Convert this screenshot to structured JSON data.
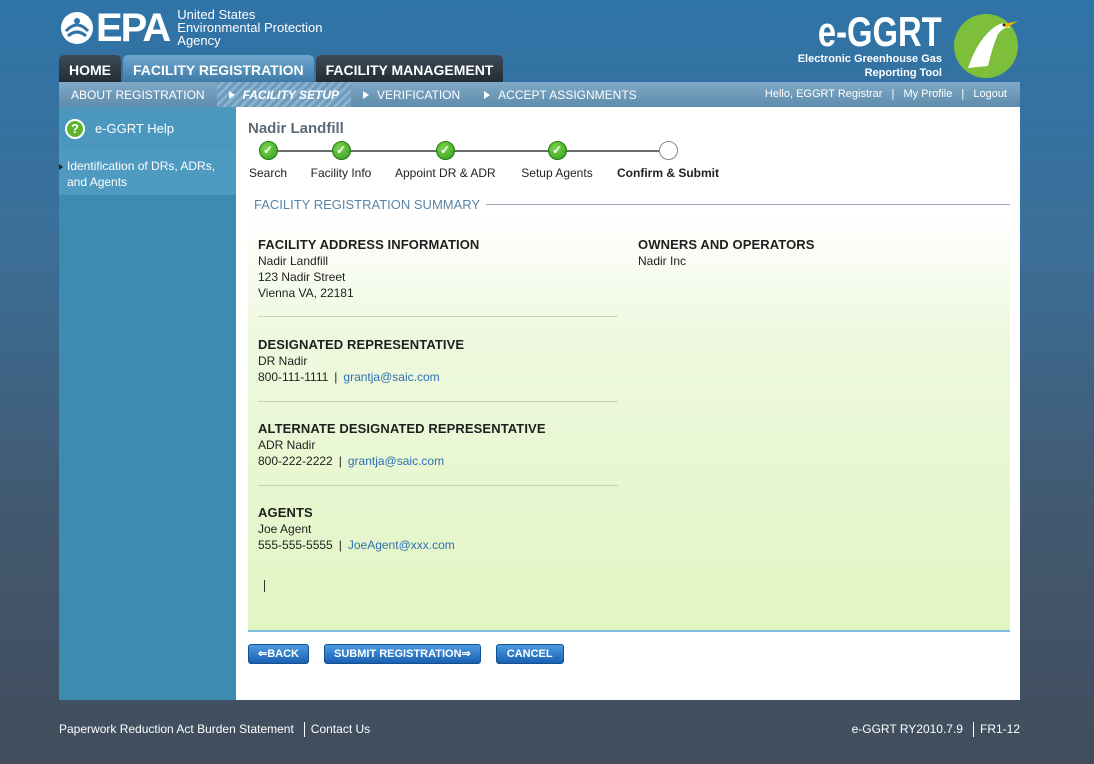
{
  "header": {
    "epa_logo_text": "EPA",
    "agency_lines": [
      "United States",
      "Environmental Protection",
      "Agency"
    ],
    "app_logo_text": "e-GGRT",
    "app_subtitle_lines": [
      "Electronic Greenhouse Gas",
      "Reporting Tool"
    ]
  },
  "main_tabs": [
    {
      "label": "HOME",
      "active": false
    },
    {
      "label": "FACILITY REGISTRATION",
      "active": true
    },
    {
      "label": "FACILITY MANAGEMENT",
      "active": false
    }
  ],
  "sub_nav": [
    {
      "label": "ABOUT REGISTRATION",
      "active": false
    },
    {
      "label": "FACILITY SETUP",
      "active": true
    },
    {
      "label": "VERIFICATION",
      "active": false
    },
    {
      "label": "ACCEPT ASSIGNMENTS",
      "active": false
    }
  ],
  "user_links": {
    "greeting": "Hello, EGGRT Registrar",
    "profile": "My Profile",
    "logout": "Logout",
    "separator": "|"
  },
  "sidebar": {
    "help_label": "e-GGRT Help",
    "help_icon": "?",
    "links": [
      "Identification of DRs, ADRs, and Agents"
    ]
  },
  "content": {
    "facility_name": "Nadir Landfill",
    "steps": [
      {
        "label": "Search",
        "done": true
      },
      {
        "label": "Facility Info",
        "done": true
      },
      {
        "label": "Appoint DR & ADR",
        "done": true
      },
      {
        "label": "Setup Agents",
        "done": true
      },
      {
        "label": "Confirm & Submit",
        "done": false
      }
    ],
    "section_title": "FACILITY REGISTRATION SUMMARY",
    "facility_address": {
      "heading": "FACILITY ADDRESS INFORMATION",
      "name": "Nadir Landfill",
      "street": "123 Nadir Street",
      "city_line": "Vienna VA, 22181"
    },
    "owners": {
      "heading": "OWNERS AND OPERATORS",
      "name": "Nadir Inc"
    },
    "dr": {
      "heading": "DESIGNATED REPRESENTATIVE",
      "name": "DR Nadir",
      "phone": "800-111-1111",
      "email": "grantja@saic.com"
    },
    "adr": {
      "heading": "ALTERNATE DESIGNATED REPRESENTATIVE",
      "name": "ADR Nadir",
      "phone": "800-222-2222",
      "email": "grantja@saic.com"
    },
    "agents": {
      "heading": "AGENTS",
      "name": "Joe Agent",
      "phone": "555-555-5555",
      "email": "JoeAgent@xxx.com"
    },
    "contact_separator": "|",
    "buttons": {
      "back": "BACK",
      "submit": "SUBMIT REGISTRATION",
      "cancel": "CANCEL"
    }
  },
  "footer": {
    "paperwork": "Paperwork Reduction Act Burden Statement",
    "contact": "Contact Us",
    "version": "e-GGRT RY2010.7.9",
    "form_id": "FR1-12"
  },
  "colors": {
    "accent_green": "#2f9a1e",
    "link_blue": "#2e6fb3",
    "button_blue": "#1a60b2"
  }
}
